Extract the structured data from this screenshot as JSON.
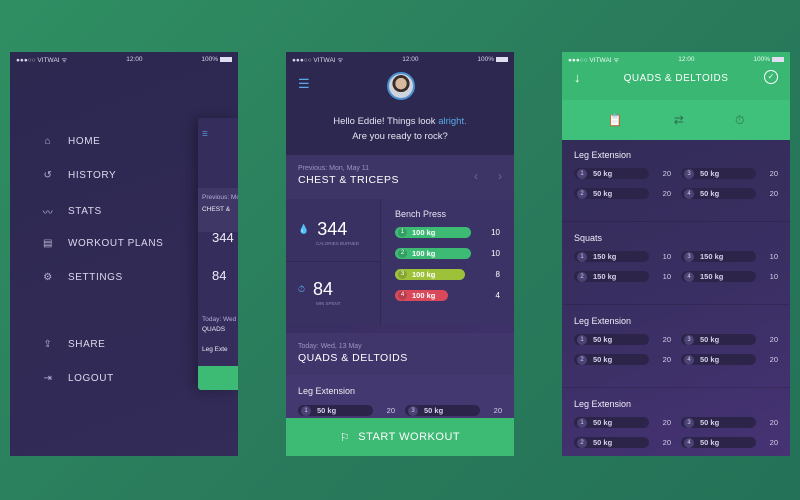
{
  "status": {
    "carrier": "●●●○○ VITWAI ᯤ",
    "time": "12:00",
    "battery": "100%"
  },
  "menu": {
    "items": [
      {
        "label": "HOME",
        "icon": "home-icon"
      },
      {
        "label": "HISTORY",
        "icon": "history-icon"
      },
      {
        "label": "STATS",
        "icon": "stats-icon"
      },
      {
        "label": "WORKOUT PLANS",
        "icon": "clipboard-icon"
      },
      {
        "label": "SETTINGS",
        "icon": "gear-icon"
      }
    ],
    "bottom": [
      {
        "label": "SHARE",
        "icon": "share-icon"
      },
      {
        "label": "LOGOUT",
        "icon": "logout-icon"
      }
    ],
    "peek": {
      "prev": "Previous: Mo",
      "prev_title": "CHEST &",
      "stat1": "344",
      "stat2": "84",
      "today": "Today: Wed",
      "today_title": "QUADS",
      "ex": "Leg Exte"
    }
  },
  "home": {
    "greeting_1": "Hello Eddie! Things look ",
    "greeting_hl": "alright.",
    "greeting_2": "Are you ready to rock?",
    "previous_label": "Previous: Mon, May 11",
    "previous_title": "CHEST & TRICEPS",
    "stats": [
      {
        "value": "344",
        "label": "CALORIES BURNED"
      },
      {
        "value": "84",
        "label": "MIN SPENT"
      }
    ],
    "bench": {
      "title": "Bench Press",
      "sets": [
        {
          "n": "1",
          "weight": "100 kg",
          "reps": "10",
          "color": "#3dba74",
          "fill": 1.0
        },
        {
          "n": "2",
          "weight": "100 kg",
          "reps": "10",
          "color": "#3dba74",
          "fill": 1.0
        },
        {
          "n": "3",
          "weight": "100 kg",
          "reps": "8",
          "color": "#9dc23a",
          "fill": 0.92
        },
        {
          "n": "4",
          "weight": "100 kg",
          "reps": "4",
          "color": "#d9495a",
          "fill": 0.7
        }
      ]
    },
    "today_label": "Today: Wed, 13 May",
    "today_title": "QUADS & DELTOIDS",
    "exercise": "Leg Extension",
    "exercise_sets": [
      {
        "n": "1",
        "weight": "50 kg",
        "reps": "20"
      },
      {
        "n": "3",
        "weight": "50 kg",
        "reps": "20"
      }
    ],
    "start_label": "START WORKOUT"
  },
  "workout": {
    "title": "QUADS & DELTOIDS",
    "exercises": [
      {
        "name": "Leg Extension",
        "sets": [
          {
            "n": "1",
            "weight": "50 kg",
            "reps": "20"
          },
          {
            "n": "3",
            "weight": "50 kg",
            "reps": "20"
          },
          {
            "n": "2",
            "weight": "50 kg",
            "reps": "20"
          },
          {
            "n": "4",
            "weight": "50 kg",
            "reps": "20"
          }
        ]
      },
      {
        "name": "Squats",
        "sets": [
          {
            "n": "1",
            "weight": "150 kg",
            "reps": "10"
          },
          {
            "n": "3",
            "weight": "150 kg",
            "reps": "10"
          },
          {
            "n": "2",
            "weight": "150 kg",
            "reps": "10"
          },
          {
            "n": "4",
            "weight": "150 kg",
            "reps": "10"
          }
        ]
      },
      {
        "name": "Leg Extension",
        "sets": [
          {
            "n": "1",
            "weight": "50 kg",
            "reps": "20"
          },
          {
            "n": "3",
            "weight": "50 kg",
            "reps": "20"
          },
          {
            "n": "2",
            "weight": "50 kg",
            "reps": "20"
          },
          {
            "n": "4",
            "weight": "50 kg",
            "reps": "20"
          }
        ]
      },
      {
        "name": "Leg Extension",
        "sets": [
          {
            "n": "1",
            "weight": "50 kg",
            "reps": "20"
          },
          {
            "n": "3",
            "weight": "50 kg",
            "reps": "20"
          },
          {
            "n": "2",
            "weight": "50 kg",
            "reps": "20"
          },
          {
            "n": "4",
            "weight": "50 kg",
            "reps": "20"
          }
        ]
      }
    ]
  },
  "colors": {
    "green": "#3dba74",
    "purple": "#2f2a52",
    "accent_blue": "#5aa8e6"
  }
}
